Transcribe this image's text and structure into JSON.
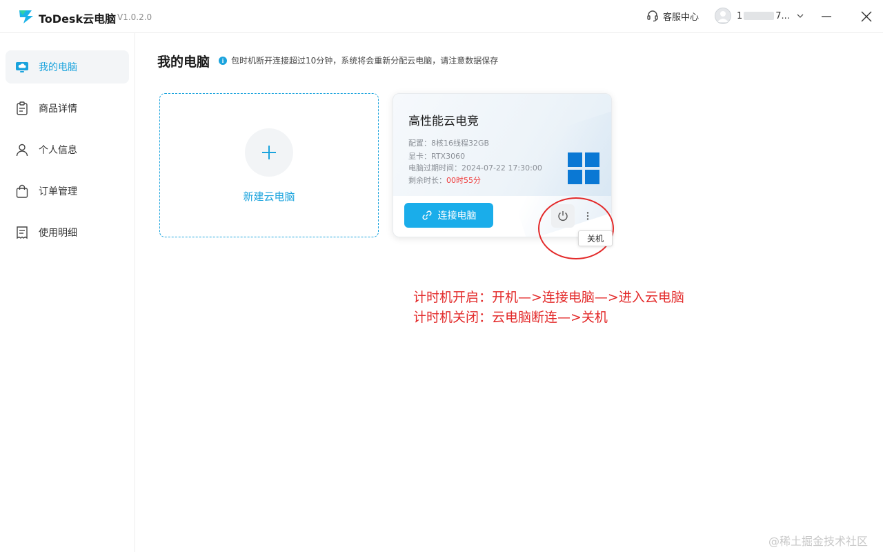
{
  "titlebar": {
    "app_name": "ToDesk云电脑",
    "version": "V1.0.2.0",
    "support_label": "客服中心",
    "user_name_start": "1",
    "user_name_end": "7..."
  },
  "sidebar": {
    "items": [
      {
        "label": "我的电脑",
        "icon": "cloud-monitor-icon",
        "active": true
      },
      {
        "label": "商品详情",
        "icon": "clipboard-icon",
        "active": false
      },
      {
        "label": "个人信息",
        "icon": "person-icon",
        "active": false
      },
      {
        "label": "订单管理",
        "icon": "shopping-bag-icon",
        "active": false
      },
      {
        "label": "使用明细",
        "icon": "receipt-icon",
        "active": false
      }
    ]
  },
  "main": {
    "title": "我的电脑",
    "notice": "包时机断开连接超过10分钟，系统将会重新分配云电脑，请注意数据保存",
    "new_card_label": "新建云电脑",
    "pc_card": {
      "title": "高性能云电竞",
      "config": "配置：8核16线程32GB",
      "gpu": "显卡：RTX3060",
      "expire": "电脑过期时间：2024-07-22 17:30:00",
      "remaining_label": "剩余时长：",
      "remaining_value": "00时55分",
      "connect_label": "连接电脑",
      "power_tooltip": "关机"
    }
  },
  "annotation": {
    "line1": "计时机开启：开机—>连接电脑—>进入云电脑",
    "line2": "计时机关闭：云电脑断连—>关机"
  },
  "watermark": "@稀土掘金技术社区",
  "colors": {
    "accent": "#1aa3dd",
    "button": "#1aadea",
    "annotation_red": "#e32a2a",
    "remaining_red": "#f03a3a"
  }
}
